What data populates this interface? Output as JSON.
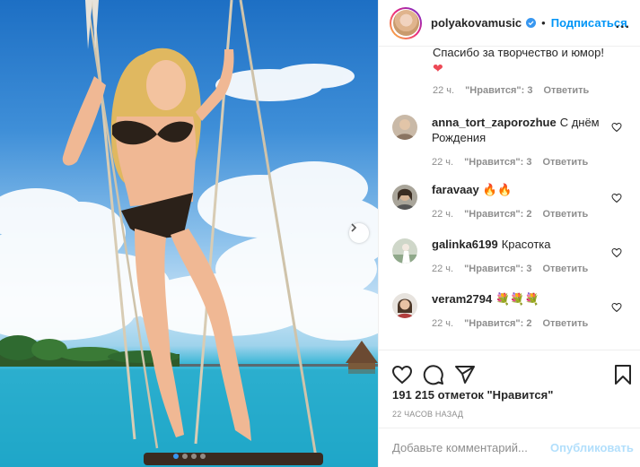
{
  "post": {
    "image_alt": "photo of woman on a swing over the sea",
    "carousel": {
      "total": 4,
      "active": 1
    }
  },
  "header": {
    "username": "polyakovamusic",
    "separator": "•",
    "follow_label": "Подписаться",
    "more_label": "..."
  },
  "top_comment": {
    "text": "Спасибо за творчество и юмор!",
    "emoji": "❤",
    "time": "22 ч.",
    "likes": "\"Нравится\": 3",
    "reply": "Ответить"
  },
  "comments": [
    {
      "user": "anna_tort_zaporozhue",
      "text": "С днём Рождения",
      "time": "22 ч.",
      "likes": "\"Нравится\": 3",
      "reply": "Ответить"
    },
    {
      "user": "faravaay",
      "text": "🔥🔥",
      "time": "22 ч.",
      "likes": "\"Нравится\": 2",
      "reply": "Ответить"
    },
    {
      "user": "galinka6199",
      "text": "Красотка",
      "time": "22 ч.",
      "likes": "\"Нравится\": 3",
      "reply": "Ответить"
    },
    {
      "user": "veram2794",
      "text": "💐💐💐",
      "time": "22 ч.",
      "likes": "\"Нравится\": 2",
      "reply": "Ответить"
    }
  ],
  "footer": {
    "likes_count": "191 215 отметок \"Нравится\"",
    "time_ago": "22 ЧАСОВ НАЗАД",
    "comment_placeholder": "Добавьте комментарий...",
    "publish_label": "Опубликовать"
  },
  "icons": {
    "like": "heart-icon",
    "comment": "comment-icon",
    "share": "share-icon",
    "save": "bookmark-icon",
    "next": "chevron-right-icon",
    "verified": "verified-badge-icon"
  },
  "colors": {
    "accent": "#0095f6",
    "verified": "#3897f0",
    "publish_disabled": "#b2dffc",
    "muted_text": "#8e8e8e"
  }
}
